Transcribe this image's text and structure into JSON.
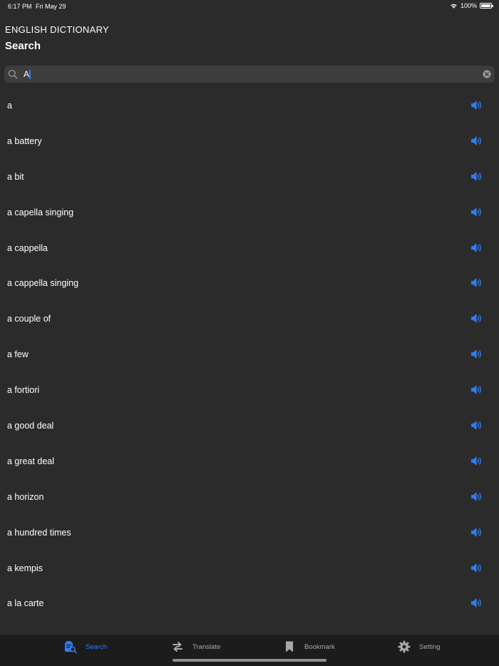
{
  "status_bar": {
    "time": "6:17 PM",
    "date": "Fri May 29",
    "battery": "100%"
  },
  "header": {
    "app_title": "ENGLISH DICTIONARY",
    "nav_title": "Search"
  },
  "search": {
    "value": "A"
  },
  "words": [
    "a",
    "a battery",
    "a bit",
    "a capella singing",
    "a cappella",
    "a cappella singing",
    "a couple of",
    "a few",
    "a fortiori",
    "a good deal",
    "a great deal",
    "a horizon",
    "a hundred times",
    "a kempis",
    "a la carte"
  ],
  "tabs": [
    {
      "label": "Search",
      "icon": "search-book-icon",
      "active": true
    },
    {
      "label": "Translate",
      "icon": "translate-arrows-icon",
      "active": false
    },
    {
      "label": "Bookmark",
      "icon": "bookmark-icon",
      "active": false
    },
    {
      "label": "Setting",
      "icon": "gear-icon",
      "active": false
    }
  ],
  "colors": {
    "background": "#2b2b2b",
    "accent": "#2f7cf6",
    "tab_bar": "#1c1c1c",
    "search_field": "#3d3d3d"
  }
}
